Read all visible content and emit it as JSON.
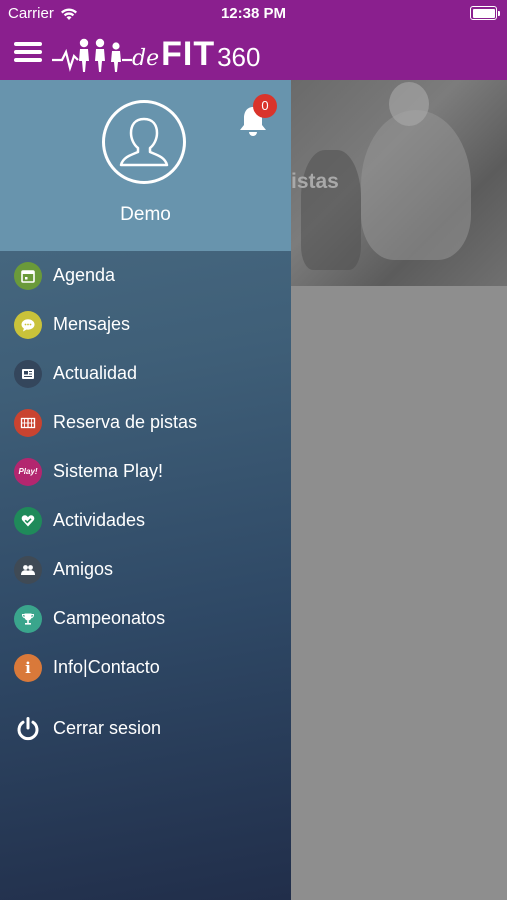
{
  "status_bar": {
    "carrier": "Carrier",
    "time": "12:38 PM"
  },
  "header": {
    "logo_de": "de",
    "logo_fit": "FIT",
    "logo_num": "360",
    "brand_color": "#8a1f8e"
  },
  "background": {
    "banner_text": "istas"
  },
  "drawer": {
    "user_name": "Demo",
    "notifications_count": "0",
    "items": [
      {
        "label": "Agenda",
        "icon": "calendar-icon",
        "color": "#6a9a3a"
      },
      {
        "label": "Mensajes",
        "icon": "chat-icon",
        "color": "#c9c23a"
      },
      {
        "label": "Actualidad",
        "icon": "newspaper-icon",
        "color": "#34465c"
      },
      {
        "label": "Reserva de pistas",
        "icon": "court-icon",
        "color": "#c94330"
      },
      {
        "label": "Sistema Play!",
        "icon": "play-icon",
        "color": "#b3266f",
        "icon_text": "Play!"
      },
      {
        "label": "Actividades",
        "icon": "heart-icon",
        "color": "#1f8a5a"
      },
      {
        "label": "Amigos",
        "icon": "friends-icon",
        "color": "#3f4a55"
      },
      {
        "label": "Campeonatos",
        "icon": "trophy-icon",
        "color": "#3aa58c"
      },
      {
        "label": "Info|Contacto",
        "icon": "info-icon",
        "color": "#d9793a",
        "icon_text": "i"
      }
    ],
    "logout_label": "Cerrar sesion"
  }
}
